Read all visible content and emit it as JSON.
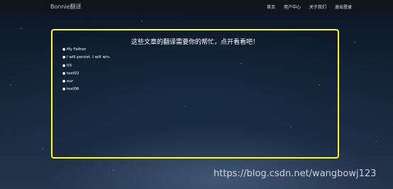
{
  "navbar": {
    "brand": "Bonnie翻译",
    "links": [
      {
        "label": "首页"
      },
      {
        "label": "用户中心"
      },
      {
        "label": "关于我们"
      },
      {
        "label": "退出登录"
      }
    ]
  },
  "panel": {
    "title": "这些文章的翻译需要你的帮忙，点开看看吧！",
    "border_color": "#ffff1a",
    "articles": [
      {
        "title": "My Father"
      },
      {
        "title": "I will persist. I will win."
      },
      {
        "title": "03"
      },
      {
        "title": "test02"
      },
      {
        "title": "our"
      },
      {
        "title": "test06"
      }
    ]
  },
  "watermark": "https://blog.csdn.net/wangbowj123"
}
